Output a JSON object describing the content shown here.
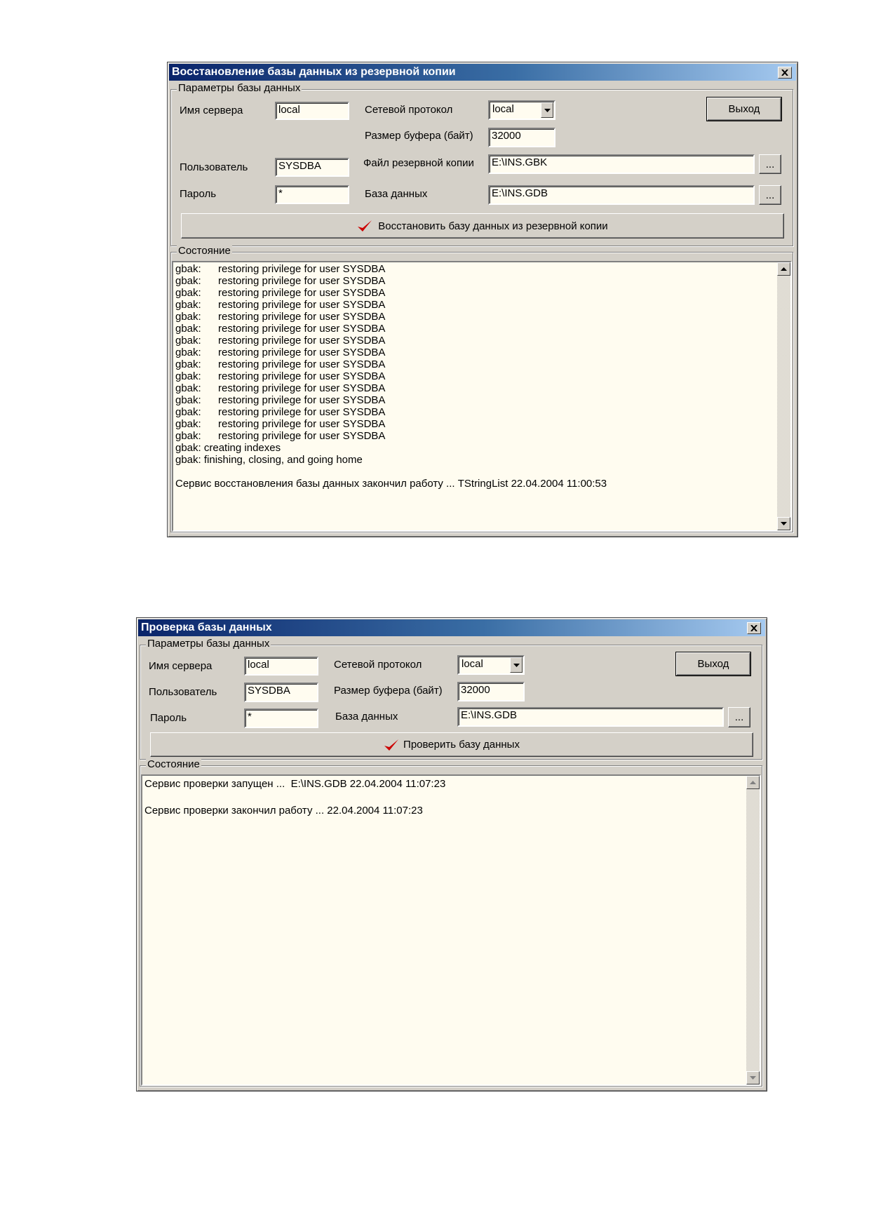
{
  "restore_window": {
    "title": "Восстановление базы данных из резервной копии",
    "params_legend": "Параметры базы данных",
    "server_label": "Имя сервера",
    "server_value": "local",
    "protocol_label": "Сетевой протокол",
    "protocol_value": "local",
    "buffer_label": "Размер буфера (байт)",
    "buffer_value": "32000",
    "user_label": "Пользователь",
    "user_value": "SYSDBA",
    "password_label": "Пароль",
    "password_value": "*",
    "backup_file_label": "Файл резервной копии",
    "backup_file_value": "E:\\INS.GBK",
    "database_label": "База данных",
    "database_value": "E:\\INS.GDB",
    "browse_label": "...",
    "exit_label": "Выход",
    "action_label": "Восстановить базу данных из резервной копии",
    "status_legend": "Состояние",
    "log_prefix": "gbak:",
    "log_privilege_message": "restoring privilege for user SYSDBA",
    "log_privilege_count": 15,
    "log_lines": [
      "gbak: creating indexes",
      "gbak: finishing, closing, and going home",
      "",
      "Сервис восстановления базы данных закончил работу ... TStringList 22.04.2004 11:00:53"
    ]
  },
  "verify_window": {
    "title": "Проверка базы данных",
    "params_legend": "Параметры базы данных",
    "server_label": "Имя сервера",
    "server_value": "local",
    "protocol_label": "Сетевой протокол",
    "protocol_value": "local",
    "user_label": "Пользователь",
    "user_value": "SYSDBA",
    "buffer_label": "Размер буфера (байт)",
    "buffer_value": "32000",
    "password_label": "Пароль",
    "password_value": "*",
    "database_label": "База данных",
    "database_value": "E:\\INS.GDB",
    "browse_label": "...",
    "exit_label": "Выход",
    "action_label": "Проверить базу данных",
    "status_legend": "Состояние",
    "log_lines": [
      "Сервис проверки запущен ...  E:\\INS.GDB 22.04.2004 11:07:23",
      "",
      "Сервис проверки закончил работу ... 22.04.2004 11:07:23"
    ]
  },
  "icons": {
    "close": "close-x-icon",
    "dropdown": "dropdown-arrow-icon",
    "check": "red-checkmark-icon",
    "scroll_up": "scroll-up-arrow-icon",
    "scroll_down": "scroll-down-arrow-icon"
  },
  "colors": {
    "title_start": "#0a246a",
    "title_end": "#a6caf0",
    "field_bg": "#fffcf0",
    "check": "#cc0000"
  }
}
